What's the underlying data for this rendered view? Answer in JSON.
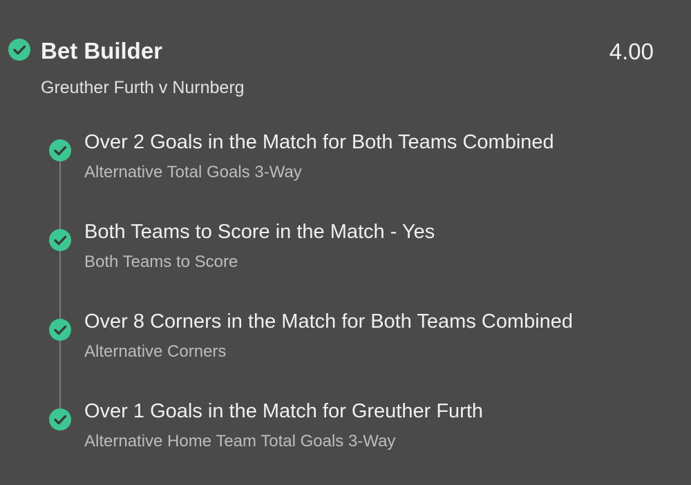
{
  "bet": {
    "title": "Bet Builder",
    "odds": "4.00",
    "match": "Greuther Furth v Nurnberg",
    "status_icon": "check-circle-icon",
    "accent_color": "#3cc692",
    "legs": [
      {
        "selection": "Over 2 Goals in the Match for Both Teams Combined",
        "market": "Alternative Total Goals 3-Way",
        "status_icon": "check-circle-icon"
      },
      {
        "selection": "Both Teams to Score in the Match - Yes",
        "market": "Both Teams to Score",
        "status_icon": "check-circle-icon"
      },
      {
        "selection": "Over 8 Corners in the Match for Both Teams Combined",
        "market": "Alternative Corners",
        "status_icon": "check-circle-icon"
      },
      {
        "selection": "Over 1 Goals in the Match for Greuther Furth",
        "market": "Alternative Home Team Total Goals 3-Way",
        "status_icon": "check-circle-icon"
      }
    ]
  }
}
